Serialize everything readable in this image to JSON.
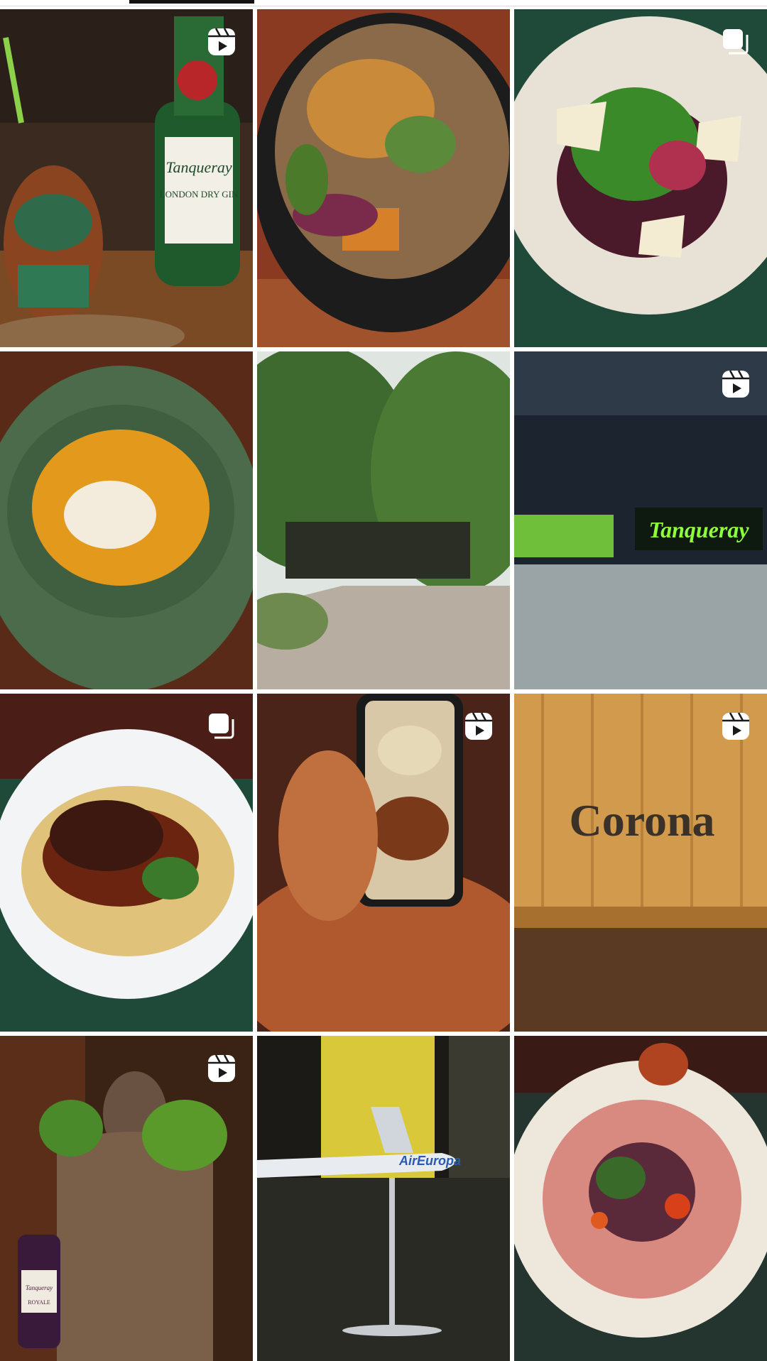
{
  "profile_tabs": [
    {
      "name": "posts-grid",
      "selected": false
    },
    {
      "name": "reels",
      "selected": true
    },
    {
      "name": "tagged",
      "selected": false
    }
  ],
  "posts": [
    {
      "subject": "Tiki mug cocktail with Tanqueray London Dry Gin bottle",
      "type": "reel",
      "bottle_label": "Tanqueray",
      "bottle_sublabel": "LONDON DRY GIN"
    },
    {
      "subject": "Rice bowl with crispy onions, pumpkin and greens",
      "type": "photo"
    },
    {
      "subject": "Green salad with brie and beet sauce",
      "type": "carousel"
    },
    {
      "subject": "Pumpkin soup with quenelle in green plate",
      "type": "photo"
    },
    {
      "subject": "Restaurant entrance among trees",
      "type": "photo"
    },
    {
      "subject": "Tanqueray neon bar shelf",
      "type": "reel",
      "neon_text": "Tanqueray"
    },
    {
      "subject": "Glazed short rib with vegetables",
      "type": "carousel"
    },
    {
      "subject": "Phone photographing a dish",
      "type": "reel"
    },
    {
      "subject": "Corona wooden crate",
      "type": "reel",
      "crate_text": "Corona"
    },
    {
      "subject": "Bronze bust with pine branches and Tanqueray Royale",
      "type": "reel",
      "bottle_label": "Tanqueray",
      "bottle_sublabel": "ROYALE"
    },
    {
      "subject": "Air Europa model plane",
      "type": "photo",
      "plane_text": "AirEuropa"
    },
    {
      "subject": "Beef carpaccio with greens and tomatoes",
      "type": "photo"
    }
  ],
  "colors": {
    "tab_indicator": "#111111",
    "badge": "#ffffff"
  }
}
